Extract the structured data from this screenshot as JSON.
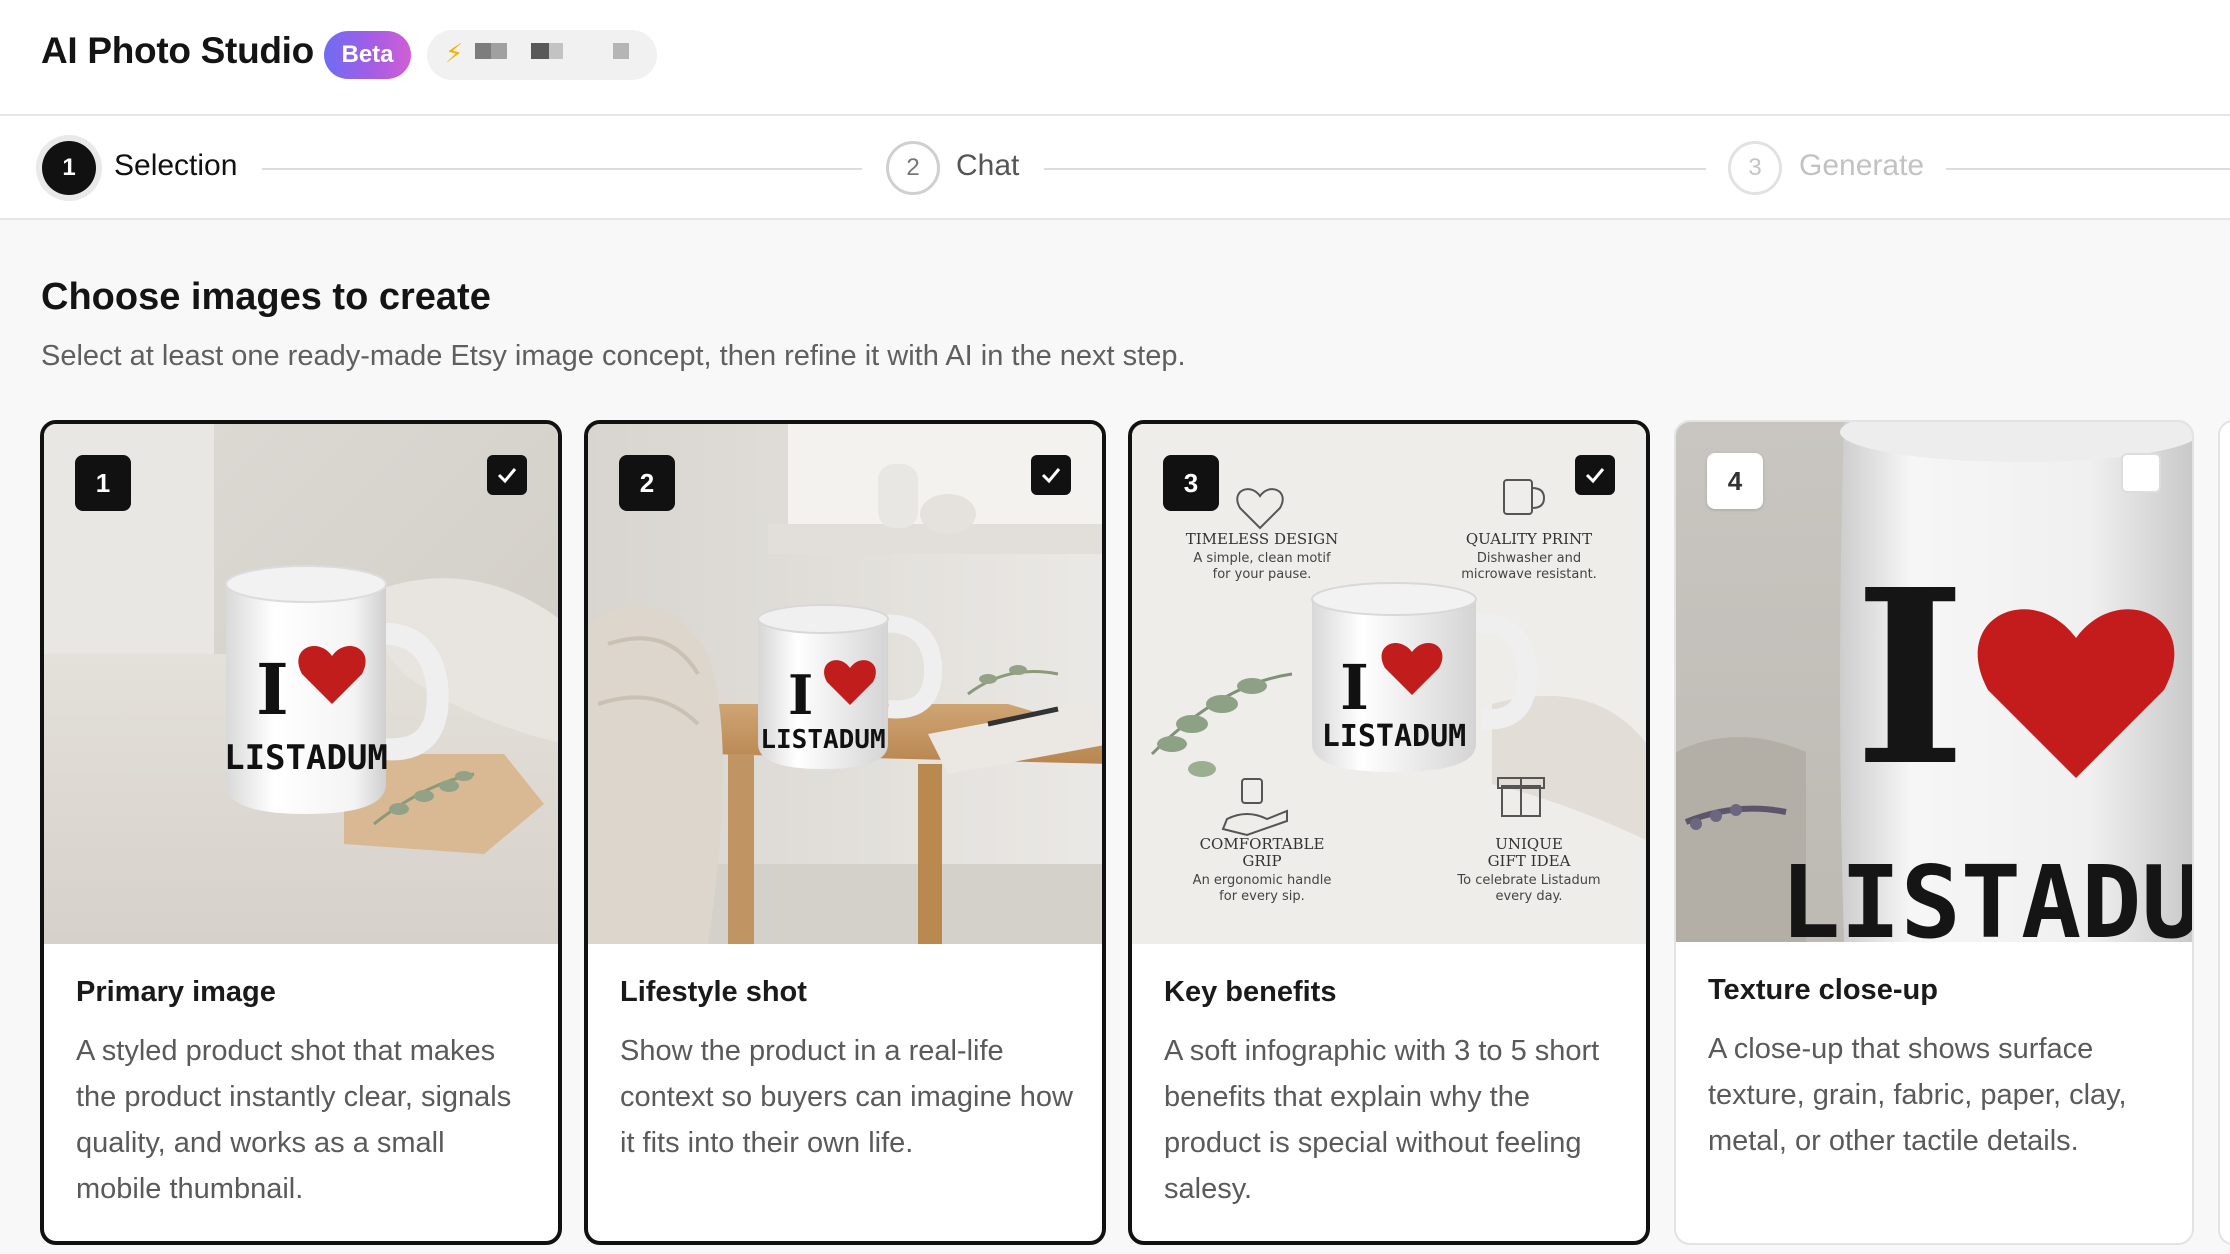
{
  "app": {
    "title": "AI Photo Studio",
    "badge": "Beta",
    "credits_icon": "lightning-bolt-icon",
    "accent_gradient": [
      "#6f6cf2",
      "#a45de6",
      "#d15ed4"
    ]
  },
  "stepper": {
    "steps": [
      {
        "number": "1",
        "label": "Selection",
        "state": "active"
      },
      {
        "number": "2",
        "label": "Chat",
        "state": "upcoming"
      },
      {
        "number": "3",
        "label": "Generate",
        "state": "disabled"
      }
    ]
  },
  "main": {
    "heading": "Choose images to create",
    "subheading": "Select at least one ready-made Etsy image concept, then refine it with AI in the next step."
  },
  "cards": [
    {
      "number": "1",
      "title": "Primary image",
      "description": "A styled product shot that makes the product instantly clear, signals quality, and works as a small mobile thumbnail.",
      "selected": true,
      "mug_text": [
        "I",
        "LISTADUM"
      ]
    },
    {
      "number": "2",
      "title": "Lifestyle shot",
      "description": "Show the product in a real-life context so buyers can imagine how it fits into their own life.",
      "selected": true,
      "mug_text": [
        "I",
        "LISTADUM"
      ]
    },
    {
      "number": "3",
      "title": "Key benefits",
      "description": "A soft infographic with 3 to 5 short benefits that explain why the product is special without feeling salesy.",
      "selected": true,
      "mug_text": [
        "I",
        "LISTADUM"
      ],
      "benefits": [
        {
          "title": "TIMELESS DESIGN",
          "lines": [
            "A simple, clean motif",
            "for your pause."
          ]
        },
        {
          "title": "QUALITY PRINT",
          "lines": [
            "Dishwasher and",
            "microwave resistant."
          ]
        },
        {
          "title": "COMFORTABLE",
          "title2": "GRIP",
          "lines": [
            "An ergonomic handle",
            "for every sip."
          ]
        },
        {
          "title": "UNIQUE",
          "title2": "GIFT IDEA",
          "lines": [
            "To celebrate Listadum",
            "every day."
          ]
        }
      ]
    },
    {
      "number": "4",
      "title": "Texture close-up",
      "description": "A close-up that shows surface texture, grain, fabric, paper, clay, metal, or other tactile details.",
      "selected": false,
      "mug_text": [
        "I",
        "LISTADUM"
      ]
    }
  ]
}
